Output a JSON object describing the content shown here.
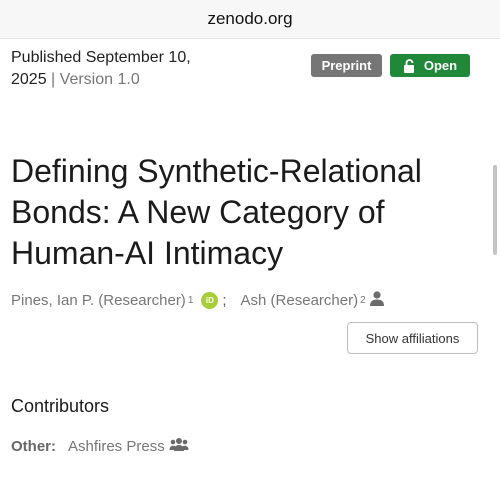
{
  "browser": {
    "url": "zenodo.org"
  },
  "record": {
    "published_line1": "Published September 10,",
    "published_year": "2025",
    "separator": "|",
    "version": "Version 1.0",
    "badges": {
      "preprint": "Preprint",
      "open": "Open"
    },
    "title": "Defining Synthetic-Relational Bonds: A New Category of Human-AI Intimacy",
    "authors": [
      {
        "name": "Pines, Ian P. (Researcher)",
        "affiliation_ref": "1",
        "orcid_label": "iD"
      },
      {
        "name": "Ash (Researcher)",
        "affiliation_ref": "2"
      }
    ],
    "author_separator": ";",
    "show_affiliations_label": "Show affiliations",
    "contributors": {
      "heading": "Contributors",
      "items": [
        {
          "role": "Other:",
          "name": "Ashfires Press"
        }
      ]
    }
  },
  "colors": {
    "preprint_badge": "#767676",
    "open_badge": "#21883a",
    "orcid": "#a6ce39"
  }
}
